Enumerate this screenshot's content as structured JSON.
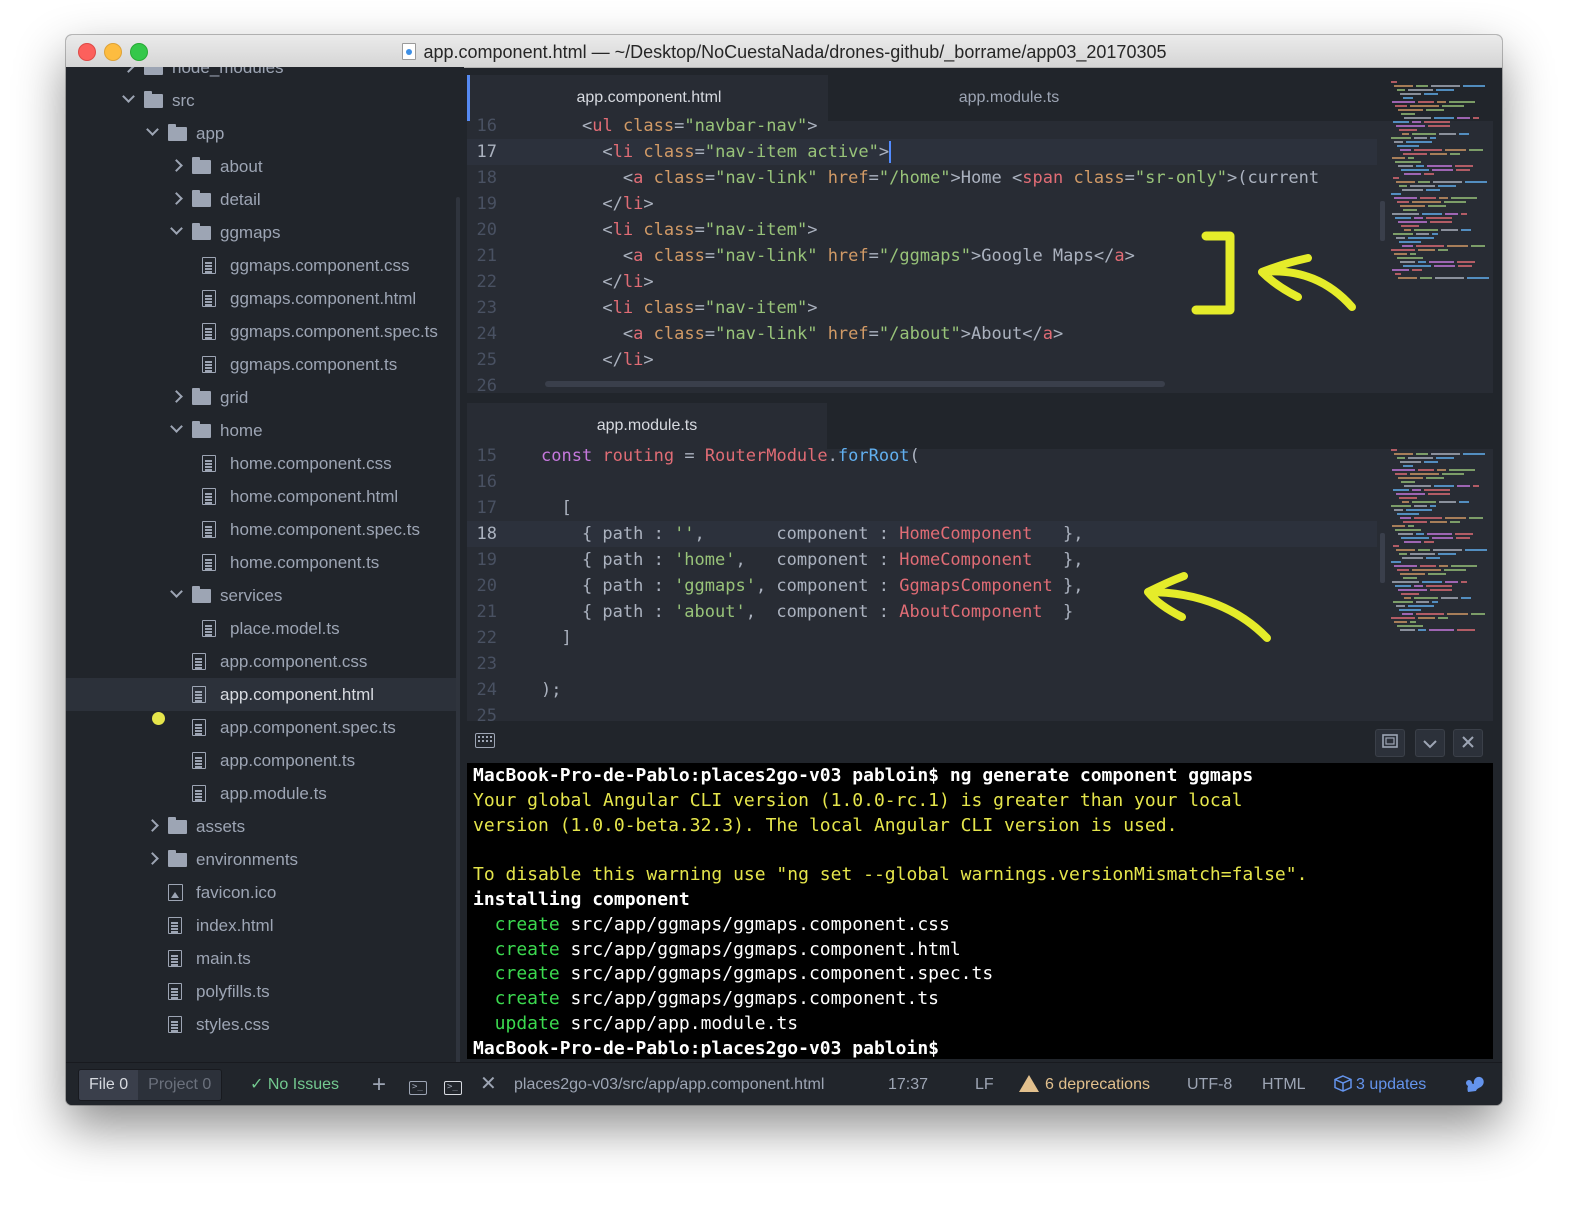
{
  "window": {
    "title": "app.component.html — ~/Desktop/NoCuestaNada/drones-github/_borrame/app03_20170305"
  },
  "sidebar": {
    "items": [
      {
        "label": "node_modules",
        "type": "folder",
        "state": "closed"
      },
      {
        "label": "src",
        "type": "folder",
        "state": "open"
      },
      {
        "label": "app",
        "type": "folder",
        "state": "open"
      },
      {
        "label": "about",
        "type": "folder",
        "state": "closed"
      },
      {
        "label": "detail",
        "type": "folder",
        "state": "closed"
      },
      {
        "label": "ggmaps",
        "type": "folder",
        "state": "open"
      },
      {
        "label": "ggmaps.component.css",
        "type": "file"
      },
      {
        "label": "ggmaps.component.html",
        "type": "file"
      },
      {
        "label": "ggmaps.component.spec.ts",
        "type": "file"
      },
      {
        "label": "ggmaps.component.ts",
        "type": "file"
      },
      {
        "label": "grid",
        "type": "folder",
        "state": "closed"
      },
      {
        "label": "home",
        "type": "folder",
        "state": "open"
      },
      {
        "label": "home.component.css",
        "type": "file"
      },
      {
        "label": "home.component.html",
        "type": "file"
      },
      {
        "label": "home.component.spec.ts",
        "type": "file"
      },
      {
        "label": "home.component.ts",
        "type": "file"
      },
      {
        "label": "services",
        "type": "folder",
        "state": "open"
      },
      {
        "label": "place.model.ts",
        "type": "file"
      },
      {
        "label": "app.component.css",
        "type": "file"
      },
      {
        "label": "app.component.html",
        "type": "file",
        "selected": true,
        "modified": true
      },
      {
        "label": "app.component.spec.ts",
        "type": "file"
      },
      {
        "label": "app.component.ts",
        "type": "file"
      },
      {
        "label": "app.module.ts",
        "type": "file"
      },
      {
        "label": "assets",
        "type": "folder",
        "state": "closed"
      },
      {
        "label": "environments",
        "type": "folder",
        "state": "closed"
      },
      {
        "label": "favicon.ico",
        "type": "image"
      },
      {
        "label": "index.html",
        "type": "file"
      },
      {
        "label": "main.ts",
        "type": "file"
      },
      {
        "label": "polyfills.ts",
        "type": "file"
      },
      {
        "label": "styles.css",
        "type": "file"
      }
    ]
  },
  "editor_top": {
    "tabs": [
      {
        "label": "app.component.html",
        "active": true
      },
      {
        "label": "app.module.ts",
        "active": false
      }
    ],
    "lines": [
      {
        "num": "16",
        "tokens": [
          [
            "t-text",
            "    "
          ],
          [
            "t-punct",
            "<"
          ],
          [
            "t-tag",
            "ul"
          ],
          [
            "t-text",
            " "
          ],
          [
            "t-attr",
            "class"
          ],
          [
            "t-punct",
            "="
          ],
          [
            "t-str",
            "\"navbar-nav\""
          ],
          [
            "t-punct",
            ">"
          ]
        ]
      },
      {
        "num": "17",
        "current": true,
        "tokens": [
          [
            "t-text",
            "      "
          ],
          [
            "t-punct",
            "<"
          ],
          [
            "t-tag",
            "li"
          ],
          [
            "t-text",
            " "
          ],
          [
            "t-attr",
            "class"
          ],
          [
            "t-punct",
            "="
          ],
          [
            "t-str",
            "\"nav-item active\""
          ],
          [
            "t-punct",
            ">"
          ]
        ]
      },
      {
        "num": "18",
        "tokens": [
          [
            "t-text",
            "        "
          ],
          [
            "t-punct",
            "<"
          ],
          [
            "t-tag",
            "a"
          ],
          [
            "t-text",
            " "
          ],
          [
            "t-attr",
            "class"
          ],
          [
            "t-punct",
            "="
          ],
          [
            "t-str",
            "\"nav-link\""
          ],
          [
            "t-text",
            " "
          ],
          [
            "t-attr",
            "href"
          ],
          [
            "t-punct",
            "="
          ],
          [
            "t-str",
            "\"/home\""
          ],
          [
            "t-punct",
            ">"
          ],
          [
            "t-text",
            "Home "
          ],
          [
            "t-punct",
            "<"
          ],
          [
            "t-tag",
            "span"
          ],
          [
            "t-text",
            " "
          ],
          [
            "t-attr",
            "class"
          ],
          [
            "t-punct",
            "="
          ],
          [
            "t-str",
            "\"sr-only\""
          ],
          [
            "t-punct",
            ">"
          ],
          [
            "t-text",
            "(current"
          ]
        ]
      },
      {
        "num": "19",
        "tokens": [
          [
            "t-text",
            "      "
          ],
          [
            "t-punct",
            "</"
          ],
          [
            "t-tag",
            "li"
          ],
          [
            "t-punct",
            ">"
          ]
        ]
      },
      {
        "num": "20",
        "tokens": [
          [
            "t-text",
            "      "
          ],
          [
            "t-punct",
            "<"
          ],
          [
            "t-tag",
            "li"
          ],
          [
            "t-text",
            " "
          ],
          [
            "t-attr",
            "class"
          ],
          [
            "t-punct",
            "="
          ],
          [
            "t-str",
            "\"nav-item\""
          ],
          [
            "t-punct",
            ">"
          ]
        ]
      },
      {
        "num": "21",
        "tokens": [
          [
            "t-text",
            "        "
          ],
          [
            "t-punct",
            "<"
          ],
          [
            "t-tag",
            "a"
          ],
          [
            "t-text",
            " "
          ],
          [
            "t-attr",
            "class"
          ],
          [
            "t-punct",
            "="
          ],
          [
            "t-str",
            "\"nav-link\""
          ],
          [
            "t-text",
            " "
          ],
          [
            "t-attr",
            "href"
          ],
          [
            "t-punct",
            "="
          ],
          [
            "t-str",
            "\"/ggmaps\""
          ],
          [
            "t-punct",
            ">"
          ],
          [
            "t-text",
            "Google Maps"
          ],
          [
            "t-punct",
            "</"
          ],
          [
            "t-tag",
            "a"
          ],
          [
            "t-punct",
            ">"
          ]
        ]
      },
      {
        "num": "22",
        "tokens": [
          [
            "t-text",
            "      "
          ],
          [
            "t-punct",
            "</"
          ],
          [
            "t-tag",
            "li"
          ],
          [
            "t-punct",
            ">"
          ]
        ]
      },
      {
        "num": "23",
        "tokens": [
          [
            "t-text",
            "      "
          ],
          [
            "t-punct",
            "<"
          ],
          [
            "t-tag",
            "li"
          ],
          [
            "t-text",
            " "
          ],
          [
            "t-attr",
            "class"
          ],
          [
            "t-punct",
            "="
          ],
          [
            "t-str",
            "\"nav-item\""
          ],
          [
            "t-punct",
            ">"
          ]
        ]
      },
      {
        "num": "24",
        "tokens": [
          [
            "t-text",
            "        "
          ],
          [
            "t-punct",
            "<"
          ],
          [
            "t-tag",
            "a"
          ],
          [
            "t-text",
            " "
          ],
          [
            "t-attr",
            "class"
          ],
          [
            "t-punct",
            "="
          ],
          [
            "t-str",
            "\"nav-link\""
          ],
          [
            "t-text",
            " "
          ],
          [
            "t-attr",
            "href"
          ],
          [
            "t-punct",
            "="
          ],
          [
            "t-str",
            "\"/about\""
          ],
          [
            "t-punct",
            ">"
          ],
          [
            "t-text",
            "About"
          ],
          [
            "t-punct",
            "</"
          ],
          [
            "t-tag",
            "a"
          ],
          [
            "t-punct",
            ">"
          ]
        ]
      },
      {
        "num": "25",
        "tokens": [
          [
            "t-text",
            "      "
          ],
          [
            "t-punct",
            "</"
          ],
          [
            "t-tag",
            "li"
          ],
          [
            "t-punct",
            ">"
          ]
        ]
      },
      {
        "num": "26",
        "tokens": []
      }
    ]
  },
  "editor_bottom": {
    "tabs": [
      {
        "label": "app.module.ts",
        "active": true
      }
    ],
    "lines": [
      {
        "num": "15",
        "tokens": [
          [
            "t-kw",
            "const"
          ],
          [
            "t-text",
            " "
          ],
          [
            "t-var",
            "routing"
          ],
          [
            "t-text",
            " = "
          ],
          [
            "t-var",
            "RouterModule"
          ],
          [
            "t-text",
            "."
          ],
          [
            "t-fn",
            "forRoot"
          ],
          [
            "t-text",
            "("
          ]
        ]
      },
      {
        "num": "16",
        "tokens": []
      },
      {
        "num": "17",
        "tokens": [
          [
            "t-text",
            "  ["
          ]
        ]
      },
      {
        "num": "18",
        "current": true,
        "tokens": [
          [
            "t-text",
            "    { path : "
          ],
          [
            "t-str",
            "''"
          ],
          [
            "t-text",
            ",       component : "
          ],
          [
            "t-comp",
            "HomeComponent"
          ],
          [
            "t-text",
            "   },"
          ]
        ]
      },
      {
        "num": "19",
        "tokens": [
          [
            "t-text",
            "    { path : "
          ],
          [
            "t-str",
            "'home'"
          ],
          [
            "t-text",
            ",   component : "
          ],
          [
            "t-comp",
            "HomeComponent"
          ],
          [
            "t-text",
            "   },"
          ]
        ]
      },
      {
        "num": "20",
        "tokens": [
          [
            "t-text",
            "    { path : "
          ],
          [
            "t-str",
            "'ggmaps'"
          ],
          [
            "t-text",
            ", component : "
          ],
          [
            "t-comp",
            "GgmapsComponent"
          ],
          [
            "t-text",
            " },"
          ]
        ]
      },
      {
        "num": "21",
        "tokens": [
          [
            "t-text",
            "    { path : "
          ],
          [
            "t-str",
            "'about'"
          ],
          [
            "t-text",
            ",  component : "
          ],
          [
            "t-comp",
            "AboutComponent"
          ],
          [
            "t-text",
            "  }"
          ]
        ]
      },
      {
        "num": "22",
        "tokens": [
          [
            "t-text",
            "  ]"
          ]
        ]
      },
      {
        "num": "23",
        "tokens": []
      },
      {
        "num": "24",
        "tokens": [
          [
            "t-text",
            ");"
          ]
        ]
      },
      {
        "num": "25",
        "tokens": []
      }
    ]
  },
  "terminal": {
    "lines": [
      {
        "style": "term-bold",
        "text": "MacBook-Pro-de-Pablo:places2go-v03 pabloin$ ng generate component ggmaps"
      },
      {
        "style": "term-yellow",
        "text": "Your global Angular CLI version (1.0.0-rc.1) is greater than your local"
      },
      {
        "style": "term-yellow",
        "text": "version (1.0.0-beta.32.3). The local Angular CLI version is used."
      },
      {
        "style": "",
        "text": ""
      },
      {
        "style": "term-yellow",
        "text": "To disable this warning use \"ng set --global warnings.versionMismatch=false\"."
      },
      {
        "style": "term-bold",
        "text": "installing component"
      },
      {
        "style": "",
        "prefix": "  create",
        "text": " src/app/ggmaps/ggmaps.component.css"
      },
      {
        "style": "",
        "prefix": "  create",
        "text": " src/app/ggmaps/ggmaps.component.html"
      },
      {
        "style": "",
        "prefix": "  create",
        "text": " src/app/ggmaps/ggmaps.component.spec.ts"
      },
      {
        "style": "",
        "prefix": "  create",
        "text": " src/app/ggmaps/ggmaps.component.ts"
      },
      {
        "style": "",
        "prefix": "  update",
        "text": " src/app/app.module.ts"
      },
      {
        "style": "term-bold",
        "text": "MacBook-Pro-de-Pablo:places2go-v03 pabloin$"
      }
    ]
  },
  "statusbar": {
    "file_tab": "File",
    "file_count": "0",
    "project_tab": "Project",
    "project_count": "0",
    "no_issues": "No Issues",
    "path": "places2go-v03/src/app/app.component.html",
    "cursor": "17:37",
    "line_ending": "LF",
    "deprecations": "6 deprecations",
    "encoding": "UTF-8",
    "grammar": "HTML",
    "updates": "3 updates"
  },
  "colors": {
    "annotation": "#e5ec2a",
    "accent": "#568af2"
  }
}
